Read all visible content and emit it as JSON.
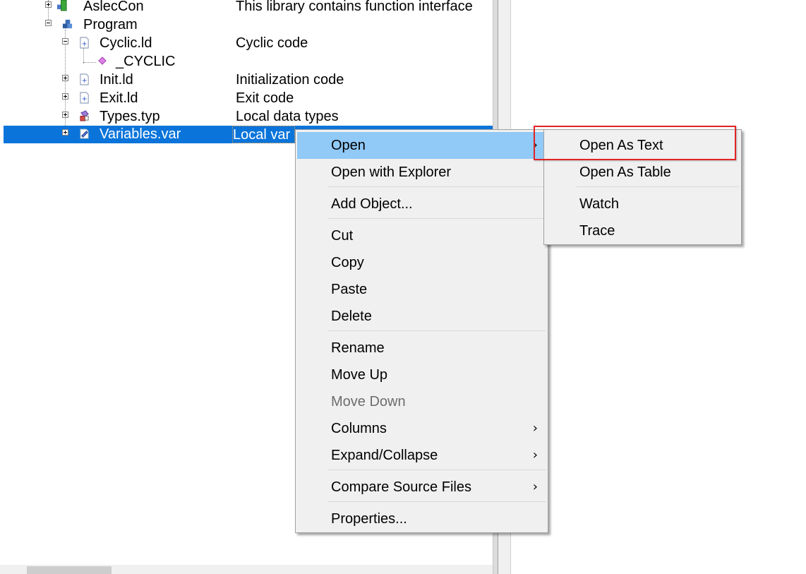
{
  "tree": {
    "rows": [
      {
        "name": "AslecCon",
        "desc": "This library contains function interface"
      },
      {
        "name": "Program",
        "desc": ""
      },
      {
        "name": "Cyclic.ld",
        "desc": "Cyclic code"
      },
      {
        "name": "_CYCLIC",
        "desc": ""
      },
      {
        "name": "Init.ld",
        "desc": "Initialization code"
      },
      {
        "name": "Exit.ld",
        "desc": "Exit code"
      },
      {
        "name": "Types.typ",
        "desc": "Local data types"
      },
      {
        "name": "Variables.var",
        "desc": "Local var"
      }
    ]
  },
  "context_menu": {
    "items": [
      {
        "label": "Open",
        "submenu": true,
        "highlighted": true
      },
      {
        "label": "Open with Explorer"
      },
      {
        "label": "Add Object..."
      },
      {
        "label": "Cut"
      },
      {
        "label": "Copy"
      },
      {
        "label": "Paste"
      },
      {
        "label": "Delete"
      },
      {
        "label": "Rename"
      },
      {
        "label": "Move Up"
      },
      {
        "label": "Move Down",
        "disabled": true
      },
      {
        "label": "Columns",
        "submenu": true
      },
      {
        "label": "Expand/Collapse",
        "submenu": true
      },
      {
        "label": "Compare Source Files",
        "submenu": true
      },
      {
        "label": "Properties..."
      }
    ]
  },
  "submenu": {
    "items": [
      {
        "label": "Open As Text"
      },
      {
        "label": "Open As Table"
      },
      {
        "label": "Watch"
      },
      {
        "label": "Trace"
      }
    ]
  },
  "colors": {
    "selection": "#0a74da",
    "menu_highlight": "#91c9f7",
    "annotation_box": "#e02424"
  },
  "icons": {
    "arrow": "›"
  }
}
